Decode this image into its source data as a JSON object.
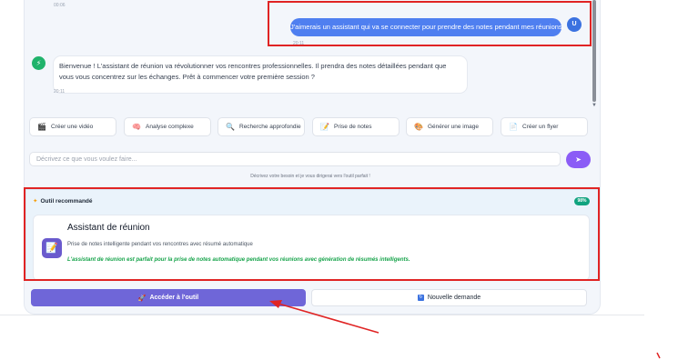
{
  "chat": {
    "user_time": "00:06",
    "user_message": "J'aimerais un assistant qui va se connecter pour prendre des notes pendant mes réunions.",
    "user_avatar_letter": "U",
    "user_msg_time": "20:11",
    "bot_message": "Bienvenue ! L'assistant de réunion va révolutionner vos rencontres professionnelles. Il prendra des notes détaillées pendant que vous vous concentrez sur les échanges. Prêt à commencer votre première session ?",
    "bot_time": "20:11"
  },
  "chips": [
    {
      "label": "Créer une vidéo",
      "icon": "clapper-board-icon",
      "glyph": "🎬"
    },
    {
      "label": "Analyse complexe",
      "icon": "brain-icon",
      "glyph": "🧠"
    },
    {
      "label": "Recherche approfondie",
      "icon": "magnifier-icon",
      "glyph": "🔍"
    },
    {
      "label": "Prise de notes",
      "icon": "memo-icon",
      "glyph": "📝"
    },
    {
      "label": "Générer une image",
      "icon": "palette-icon",
      "glyph": "🎨"
    },
    {
      "label": "Créer un flyer",
      "icon": "document-icon",
      "glyph": "📄"
    }
  ],
  "input": {
    "placeholder": "Décrivez ce que vous voulez faire...",
    "hint": "Décrivez votre besoin et je vous dirigerai vers l'outil parfait !"
  },
  "recommendation": {
    "title": "Outil recommandé",
    "score": "98%",
    "tool_name": "Assistant de réunion",
    "description": "Prise de notes intelligente pendant vos rencontres avec résumé automatique",
    "reason": "L'assistant de réunion est parfait pour la prise de notes automatique pendant vos réunions avec génération de résumés intelligents."
  },
  "actions": {
    "access_label": "Accéder à l'outil",
    "new_request_label": "Nouvelle demande"
  },
  "colors": {
    "user_bubble": "#4f7ff0",
    "accent_purple": "#8b5cf6",
    "primary_button": "#6f66d8",
    "score_badge": "#10a37f",
    "annotation_red": "#e02424"
  }
}
